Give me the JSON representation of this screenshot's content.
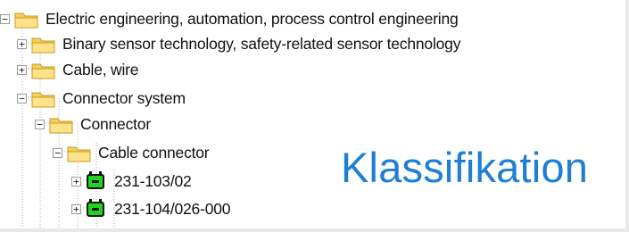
{
  "tree": {
    "items": [
      {
        "label": "Electric engineering, automation, process control engineering",
        "expanded": true,
        "icon": "folder-icon"
      },
      {
        "label": "Binary sensor technology, safety-related sensor technology",
        "expanded": false,
        "icon": "folder-icon"
      },
      {
        "label": "Cable, wire",
        "expanded": false,
        "icon": "folder-icon"
      },
      {
        "label": "Connector system",
        "expanded": true,
        "icon": "folder-icon"
      },
      {
        "label": "Connector",
        "expanded": true,
        "icon": "folder-icon"
      },
      {
        "label": "Cable connector",
        "expanded": true,
        "icon": "folder-icon"
      },
      {
        "label": "231-103/02",
        "expanded": false,
        "icon": "plug-connector-icon"
      },
      {
        "label": "231-104/026-000",
        "expanded": false,
        "icon": "plug-connector-icon"
      }
    ]
  },
  "overlay": {
    "text": "Klassifikation"
  },
  "colors": {
    "overlay_text": "#1f7fd4",
    "plug_green": "#1ed61e",
    "folder_yellow": "#f3cf5b"
  }
}
